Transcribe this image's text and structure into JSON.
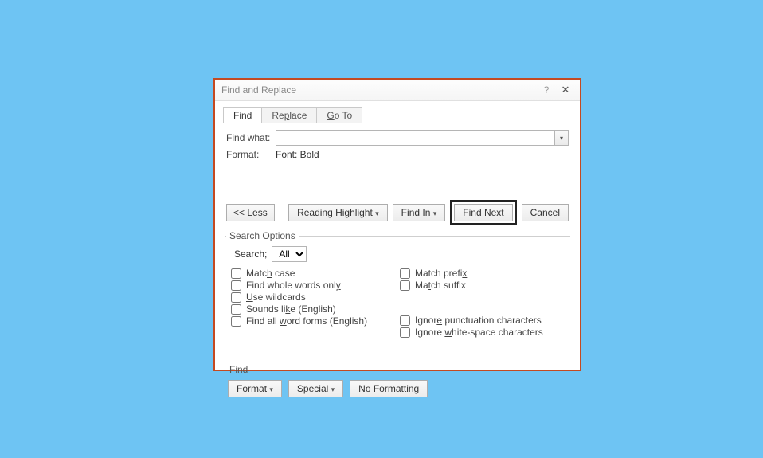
{
  "dialog": {
    "title": "Find and Replace",
    "help_glyph": "?",
    "close_glyph": "✕"
  },
  "tabs": {
    "find": "Find",
    "replace_pre": "Re",
    "replace_u": "p",
    "replace_post": "lace",
    "goto_pre": "",
    "goto_u": "G",
    "goto_post": "o To"
  },
  "main": {
    "find_what_label_pre": "Fi",
    "find_what_label_u": "n",
    "find_what_label_post": "d what:",
    "find_what_value": "",
    "format_label": "Format:",
    "format_value": "Font: Bold"
  },
  "buttons": {
    "less_pre": "<< ",
    "less_u": "L",
    "less_post": "ess",
    "reading_pre": "",
    "reading_u": "R",
    "reading_post": "eading Highlight",
    "findin_pre": "F",
    "findin_u": "i",
    "findin_post": "nd In",
    "find_next_pre": "",
    "find_next_u": "F",
    "find_next_post": "ind Next",
    "cancel": "Cancel"
  },
  "search_options": {
    "legend": "Search Options",
    "search_label": "Search;",
    "direction": "All",
    "left": {
      "match_case_pre": "Matc",
      "match_case_u": "h",
      "match_case_post": " case",
      "whole_words_pre": "Find whole words onl",
      "whole_words_u": "y",
      "whole_words_post": "",
      "wildcards_pre": "",
      "wildcards_u": "U",
      "wildcards_post": "se wildcards",
      "sounds_pre": "Sounds li",
      "sounds_u": "k",
      "sounds_post": "e (English)",
      "wordforms_pre": "Find all ",
      "wordforms_u": "w",
      "wordforms_post": "ord forms (English)"
    },
    "right": {
      "match_prefix_pre": "Match prefi",
      "match_prefix_u": "x",
      "match_prefix_post": "",
      "match_suffix_pre": "Ma",
      "match_suffix_u": "t",
      "match_suffix_post": "ch suffix",
      "ignore_punct_pre": "Ignor",
      "ignore_punct_u": "e",
      "ignore_punct_post": " punctuation characters",
      "ignore_ws_pre": "Ignore ",
      "ignore_ws_u": "w",
      "ignore_ws_post": "hite-space characters"
    }
  },
  "footer": {
    "legend": "Find",
    "format_pre": "F",
    "format_u": "o",
    "format_post": "rmat",
    "special_pre": "Sp",
    "special_u": "e",
    "special_post": "cial",
    "noformat_pre": "No For",
    "noformat_u": "m",
    "noformat_post": "atting"
  }
}
